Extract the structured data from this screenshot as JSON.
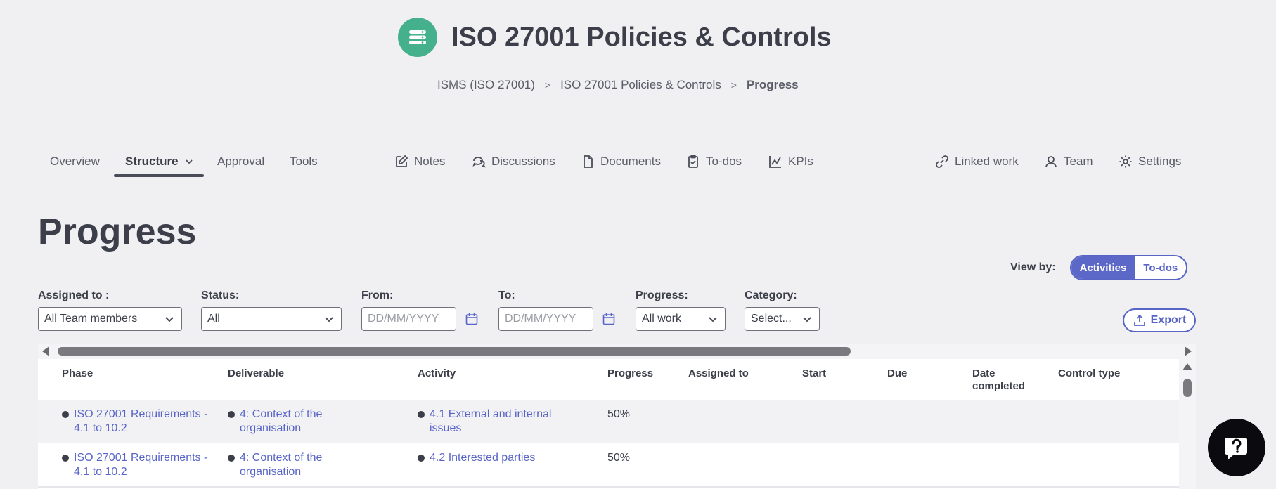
{
  "header": {
    "title": "ISO 27001 Policies & Controls",
    "breadcrumb": [
      "ISMS (ISO 27001)",
      "ISO 27001 Policies & Controls",
      "Progress"
    ]
  },
  "tabs": {
    "overview": "Overview",
    "structure": "Structure",
    "approval": "Approval",
    "tools": "Tools",
    "notes": "Notes",
    "discussions": "Discussions",
    "documents": "Documents",
    "todos": "To-dos",
    "kpis": "KPIs",
    "linked_work": "Linked work",
    "team": "Team",
    "settings": "Settings"
  },
  "page": {
    "title": "Progress"
  },
  "view_by": {
    "label": "View by:",
    "options": [
      "Activities",
      "To-dos"
    ],
    "selected": "Activities"
  },
  "filters": {
    "assigned": {
      "label": "Assigned to :",
      "value": "All Team members"
    },
    "status": {
      "label": "Status:",
      "value": "All"
    },
    "from": {
      "label": "From:",
      "placeholder": "DD/MM/YYYY"
    },
    "to": {
      "label": "To:",
      "placeholder": "DD/MM/YYYY"
    },
    "progress": {
      "label": "Progress:",
      "value": "All work"
    },
    "category": {
      "label": "Category:",
      "value": "Select..."
    }
  },
  "export_label": "Export",
  "table": {
    "columns": [
      "Phase",
      "Deliverable",
      "Activity",
      "Progress",
      "Assigned to",
      "Start",
      "Due",
      "Date completed",
      "Control type"
    ],
    "rows": [
      {
        "phase": "ISO 27001 Requirements - 4.1 to 10.2",
        "deliverable": "4: Context of the organisation",
        "activity": "4.1 External and internal issues",
        "progress": "50%"
      },
      {
        "phase": "ISO 27001 Requirements - 4.1 to 10.2",
        "deliverable": "4: Context of the organisation",
        "activity": "4.2 Interested parties",
        "progress": "50%"
      }
    ]
  },
  "colors": {
    "accent": "#5865c7",
    "logo": "#45b08c"
  }
}
